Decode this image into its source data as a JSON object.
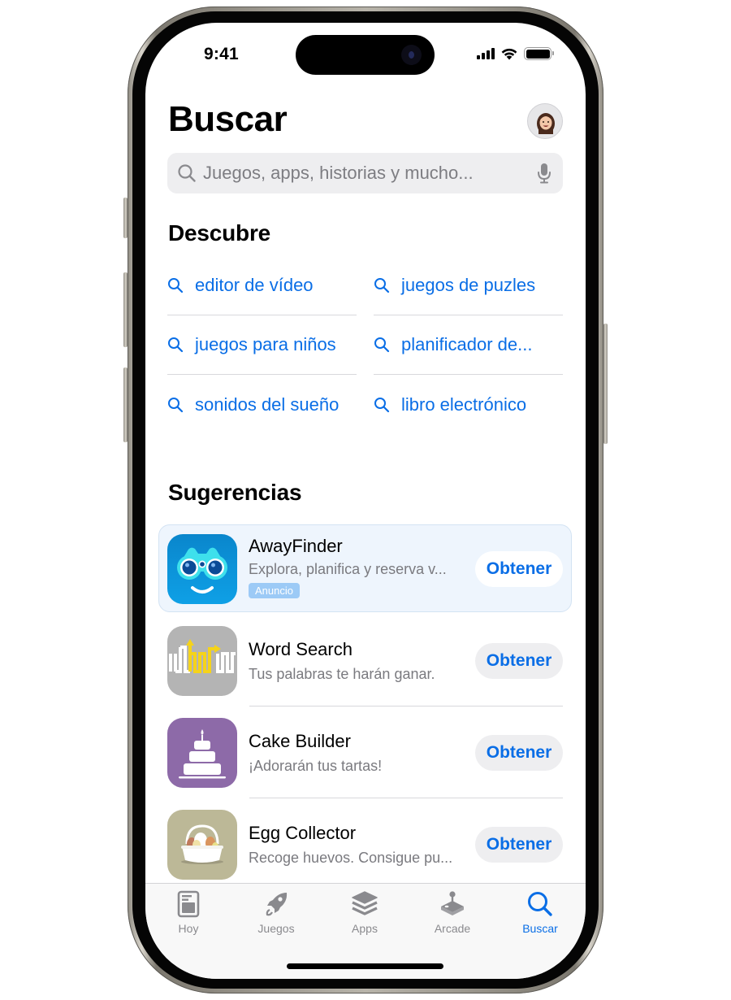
{
  "status_bar": {
    "time": "9:41"
  },
  "header": {
    "title": "Buscar",
    "avatar_icon": "memoji-avatar-icon"
  },
  "search": {
    "placeholder": "Juegos, apps, historias y mucho...",
    "value": "",
    "search_icon": "magnifier-icon",
    "mic_icon": "microphone-icon"
  },
  "discover": {
    "title": "Descubre",
    "items": [
      {
        "label": "editor de vídeo"
      },
      {
        "label": "juegos de puzles"
      },
      {
        "label": "juegos para niños"
      },
      {
        "label": "planificador de..."
      },
      {
        "label": "sonidos del sueño"
      },
      {
        "label": "libro electrónico"
      }
    ]
  },
  "suggestions": {
    "title": "Sugerencias",
    "apps": [
      {
        "name": "AwayFinder",
        "subtitle": "Explora, planifica y reserva v...",
        "badge": "Anuncio",
        "button": "Obtener",
        "icon": "binoculars-app-icon",
        "icon_color": "#0a8fd6"
      },
      {
        "name": "Word Search",
        "subtitle": "Tus palabras te harán ganar.",
        "button": "Obtener",
        "icon": "word-search-app-icon",
        "icon_color": "#b4b4b4"
      },
      {
        "name": "Cake Builder",
        "subtitle": "¡Adorarán tus tartas!",
        "button": "Obtener",
        "icon": "cake-app-icon",
        "icon_color": "#8d6aa8"
      },
      {
        "name": "Egg Collector",
        "subtitle": "Recoge huevos. Consigue pu...",
        "button": "Obtener",
        "icon": "egg-basket-app-icon",
        "icon_color": "#bcb897"
      }
    ]
  },
  "tab_bar": {
    "active": "Buscar",
    "accent_color": "#0a6ee6",
    "tabs": [
      {
        "label": "Hoy",
        "icon": "today-icon"
      },
      {
        "label": "Juegos",
        "icon": "rocket-icon"
      },
      {
        "label": "Apps",
        "icon": "layers-icon"
      },
      {
        "label": "Arcade",
        "icon": "joystick-icon"
      },
      {
        "label": "Buscar",
        "icon": "search-icon"
      }
    ]
  }
}
